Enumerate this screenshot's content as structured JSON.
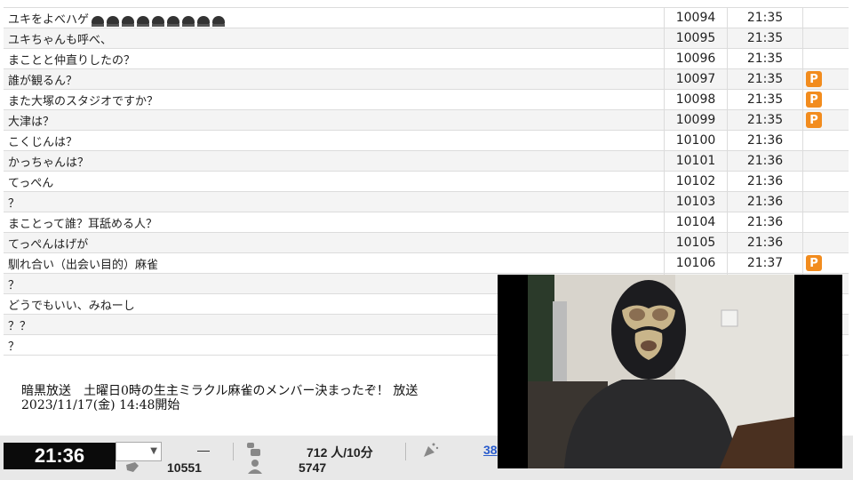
{
  "comments": [
    {
      "text": "ユキをよべハゲ",
      "onigiri": 9,
      "no": "10094",
      "time": "21:35",
      "premium": false
    },
    {
      "text": "ユキちゃんも呼べ、",
      "no": "10095",
      "time": "21:35",
      "premium": false
    },
    {
      "text": "まことと仲直りしたの？",
      "no": "10096",
      "time": "21:35",
      "premium": false
    },
    {
      "text": "誰が観るん？",
      "no": "10097",
      "time": "21:35",
      "premium": true
    },
    {
      "text": "また大塚のスタジオですか？",
      "no": "10098",
      "time": "21:35",
      "premium": true
    },
    {
      "text": "大津は？",
      "no": "10099",
      "time": "21:35",
      "premium": true
    },
    {
      "text": "こくじんは？",
      "no": "10100",
      "time": "21:36",
      "premium": false
    },
    {
      "text": "かっちゃんは？",
      "no": "10101",
      "time": "21:36",
      "premium": false
    },
    {
      "text": "てっぺん",
      "no": "10102",
      "time": "21:36",
      "premium": false
    },
    {
      "text": "？",
      "no": "10103",
      "time": "21:36",
      "premium": false
    },
    {
      "text": "まことって誰？耳舐める人？",
      "no": "10104",
      "time": "21:36",
      "premium": false
    },
    {
      "text": "てっぺんはげが",
      "no": "10105",
      "time": "21:36",
      "premium": false
    },
    {
      "text": "馴れ合い（出会い目的）麻雀",
      "no": "10106",
      "time": "21:37",
      "premium": true
    },
    {
      "text": "？",
      "no": "",
      "time": "",
      "premium": false
    },
    {
      "text": "どうでもいい、みねーし",
      "no": "",
      "time": "",
      "premium": false
    },
    {
      "text": "？？",
      "no": "",
      "time": "",
      "premium": false
    },
    {
      "text": "？",
      "no": "",
      "time": "",
      "premium": false
    }
  ],
  "premium_badge": "P",
  "broadcast": {
    "title": "暗黒放送　土曜日0時の生主ミラクル麻雀のメンバー決まったぞ！ 放送",
    "started": "2023/11/17(金) 14:48開始"
  },
  "status_bar": {
    "clock": "21:36",
    "select_value": "",
    "dash": "—",
    "comment_count": "10551",
    "viewers_label": "712 人/10分",
    "visitors": "5747",
    "link_partial": "38"
  },
  "colors": {
    "premium": "#f28c1e",
    "clock_bg": "#0b0b0b",
    "link": "#2a5ccc"
  }
}
